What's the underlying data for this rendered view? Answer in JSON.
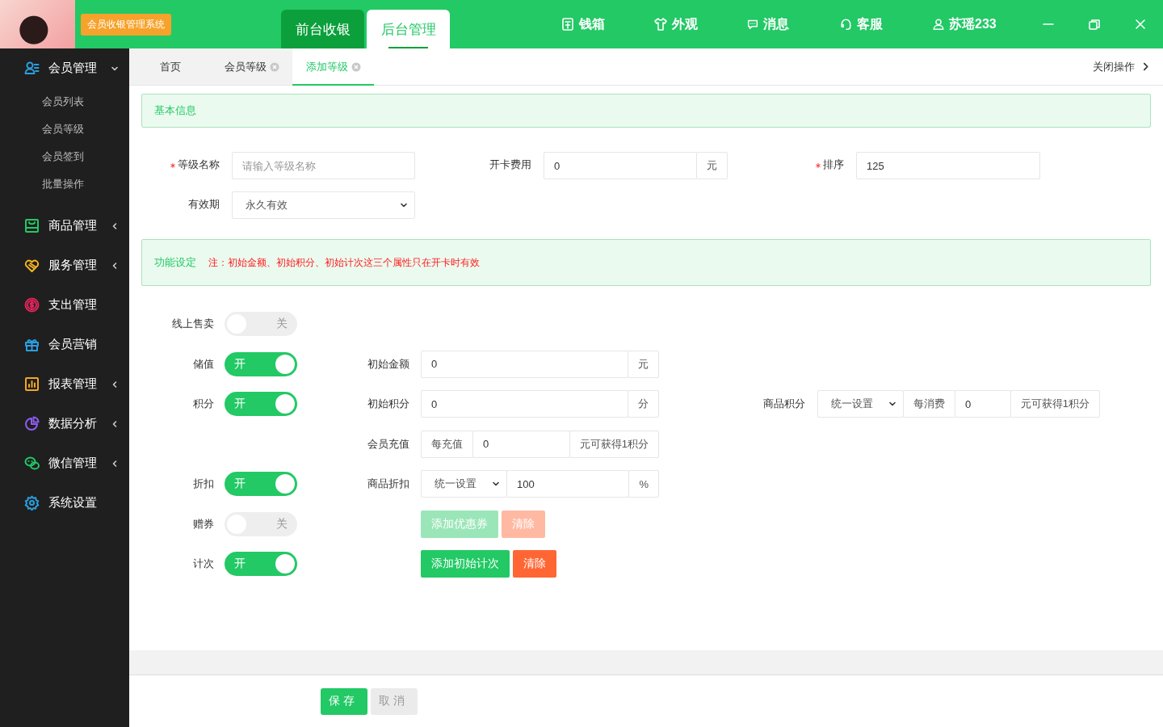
{
  "header": {
    "app_name": "会员收银管理系统",
    "mode_tabs": [
      {
        "label": "前台收银",
        "selected": false
      },
      {
        "label": "后台管理",
        "selected": true
      }
    ],
    "nav": [
      {
        "label": "钱箱"
      },
      {
        "label": "外观"
      },
      {
        "label": "消息"
      },
      {
        "label": "客服"
      },
      {
        "label": "苏瑶233"
      }
    ]
  },
  "sidebar": {
    "items": [
      {
        "label": "会员管理",
        "color": "#2a9fe0",
        "kind": "group",
        "expanded": true,
        "children": [
          {
            "label": "会员列表"
          },
          {
            "label": "会员等级"
          },
          {
            "label": "会员签到"
          },
          {
            "label": "批量操作"
          }
        ]
      },
      {
        "label": "商品管理",
        "color": "#22c965",
        "kind": "group",
        "expanded": false
      },
      {
        "label": "服务管理",
        "color": "#f5b522",
        "kind": "group",
        "expanded": false
      },
      {
        "label": "支出管理",
        "color": "#e0245e",
        "kind": "link"
      },
      {
        "label": "会员营销",
        "color": "#2a9fe0",
        "kind": "link"
      },
      {
        "label": "报表管理",
        "color": "#f5a623",
        "kind": "group",
        "expanded": false
      },
      {
        "label": "数据分析",
        "color": "#8e5cf0",
        "kind": "group",
        "expanded": false
      },
      {
        "label": "微信管理",
        "color": "#22c965",
        "kind": "group",
        "expanded": false
      },
      {
        "label": "系统设置",
        "color": "#2a9fe0",
        "kind": "link"
      }
    ]
  },
  "page_tabs": {
    "tabs": [
      {
        "label": "首页",
        "selected": false,
        "closable": false
      },
      {
        "label": "会员等级",
        "selected": false,
        "closable": true
      },
      {
        "label": "添加等级",
        "selected": true,
        "closable": true
      }
    ],
    "close_all": "关闭操作"
  },
  "basic": {
    "title": "基本信息",
    "fields": [
      {
        "label": "等级名称",
        "required": true,
        "parts": [
          {
            "kind": "input",
            "placeholder": "请输入等级名称"
          }
        ]
      },
      {
        "label": "开卡费用",
        "required": false,
        "parts": [
          {
            "kind": "input",
            "value": "0"
          },
          {
            "kind": "addon",
            "text": "元"
          }
        ]
      },
      {
        "label": "排序",
        "required": true,
        "parts": [
          {
            "kind": "input",
            "value": "125"
          }
        ]
      },
      {
        "label": "有效期",
        "required": false,
        "parts": [
          {
            "kind": "select",
            "value": "永久有效"
          }
        ]
      }
    ]
  },
  "functions": {
    "title": "功能设定",
    "note": "注：初始金额、初始积分、初始计次这三个属性只在开卡时有效",
    "rows": [
      {
        "toggle": {
          "label": "线上售卖",
          "on": false,
          "text": "关"
        }
      },
      {
        "toggle": {
          "label": "储值",
          "on": true,
          "text": "开"
        },
        "middle": {
          "label": "初始金额",
          "parts": [
            {
              "kind": "input",
              "value": "0"
            },
            {
              "kind": "addon",
              "text": "元"
            }
          ]
        }
      },
      {
        "toggle": {
          "label": "积分",
          "on": true,
          "text": "开"
        },
        "middle": {
          "label": "初始积分",
          "parts": [
            {
              "kind": "input",
              "value": "0"
            },
            {
              "kind": "addon",
              "text": "分"
            }
          ]
        },
        "right": {
          "label": "商品积分",
          "parts": [
            {
              "kind": "select",
              "value": "统一设置"
            },
            {
              "kind": "addon",
              "text": "每消费"
            },
            {
              "kind": "input",
              "value": "0"
            },
            {
              "kind": "addon",
              "text": "元可获得1积分"
            }
          ]
        }
      },
      {
        "middle": {
          "label": "会员充值",
          "parts": [
            {
              "kind": "addon",
              "text": "每充值"
            },
            {
              "kind": "input",
              "value": "0"
            },
            {
              "kind": "addon",
              "text": "元可获得1积分"
            }
          ]
        }
      },
      {
        "toggle": {
          "label": "折扣",
          "on": true,
          "text": "开"
        },
        "middle": {
          "label": "商品折扣",
          "parts": [
            {
              "kind": "select",
              "value": "统一设置"
            },
            {
              "kind": "input",
              "value": "100"
            },
            {
              "kind": "addon",
              "text": "%"
            }
          ]
        }
      },
      {
        "toggle": {
          "label": "赠券",
          "on": false,
          "text": "关"
        },
        "buttons": [
          {
            "label": "添加优惠券",
            "kind": "primary",
            "disabled": true
          },
          {
            "label": "清除",
            "kind": "danger",
            "disabled": true
          }
        ]
      },
      {
        "toggle": {
          "label": "计次",
          "on": true,
          "text": "开"
        },
        "buttons": [
          {
            "label": "添加初始计次",
            "kind": "primary",
            "disabled": false
          },
          {
            "label": "清除",
            "kind": "danger",
            "disabled": false
          }
        ]
      }
    ]
  },
  "footer": {
    "buttons": [
      {
        "label": "保存",
        "kind": "primary"
      },
      {
        "label": "取消",
        "kind": "default"
      }
    ]
  }
}
